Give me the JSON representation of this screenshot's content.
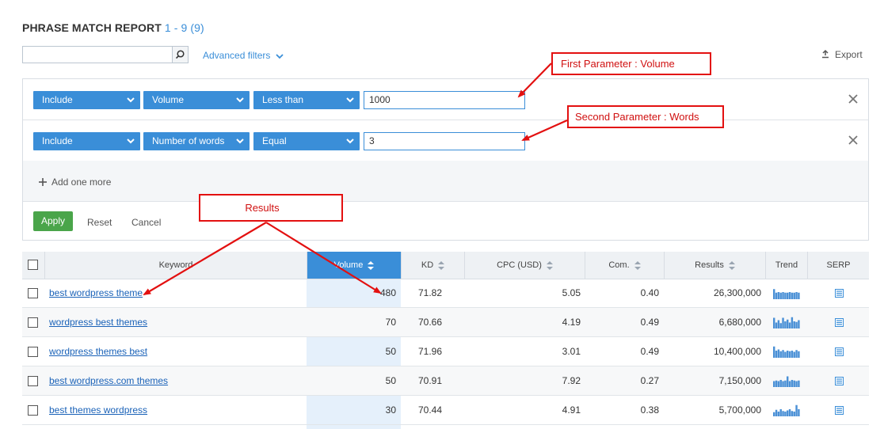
{
  "header": {
    "title": "PHRASE MATCH REPORT",
    "range": "1 - 9 (9)",
    "search_placeholder": "",
    "advanced_filters": "Advanced filters",
    "export": "Export"
  },
  "filters": [
    {
      "mode": "Include",
      "field": "Volume",
      "operator": "Less than",
      "value": "1000"
    },
    {
      "mode": "Include",
      "field": "Number of words",
      "operator": "Equal",
      "value": "3"
    }
  ],
  "filter_actions": {
    "add_one_more": "Add one more",
    "apply": "Apply",
    "reset": "Reset",
    "cancel": "Cancel"
  },
  "table": {
    "columns": [
      "Keyword",
      "Volume",
      "KD",
      "CPC (USD)",
      "Com.",
      "Results",
      "Trend",
      "SERP"
    ],
    "rows": [
      {
        "keyword": "best wordpress theme",
        "volume": "480",
        "kd": "71.82",
        "cpc": "5.05",
        "com": "0.40",
        "results": "26,300,000",
        "trend": [
          0.85,
          0.55,
          0.6,
          0.55,
          0.6,
          0.55,
          0.55,
          0.6,
          0.55,
          0.55,
          0.6,
          0.55
        ]
      },
      {
        "keyword": "wordpress best themes",
        "volume": "70",
        "kd": "70.66",
        "cpc": "4.19",
        "com": "0.49",
        "results": "6,680,000",
        "trend": [
          0.9,
          0.5,
          0.7,
          0.45,
          0.9,
          0.6,
          0.75,
          0.5,
          0.95,
          0.6,
          0.55,
          0.7
        ]
      },
      {
        "keyword": "wordpress themes best",
        "volume": "50",
        "kd": "71.96",
        "cpc": "3.01",
        "com": "0.49",
        "results": "10,400,000",
        "trend": [
          0.95,
          0.6,
          0.7,
          0.55,
          0.65,
          0.5,
          0.6,
          0.55,
          0.6,
          0.5,
          0.65,
          0.55
        ]
      },
      {
        "keyword": "best wordpress.com themes",
        "volume": "50",
        "kd": "70.91",
        "cpc": "7.92",
        "com": "0.27",
        "results": "7,150,000",
        "trend": [
          0.5,
          0.55,
          0.5,
          0.6,
          0.5,
          0.55,
          0.9,
          0.5,
          0.6,
          0.55,
          0.5,
          0.55
        ]
      },
      {
        "keyword": "best themes wordpress",
        "volume": "30",
        "kd": "70.44",
        "cpc": "4.91",
        "com": "0.38",
        "results": "5,700,000",
        "trend": [
          0.35,
          0.55,
          0.4,
          0.6,
          0.45,
          0.4,
          0.5,
          0.6,
          0.45,
          0.4,
          0.95,
          0.6
        ]
      }
    ]
  },
  "annotations": {
    "first": "First Parameter : Volume",
    "second": "Second Parameter : Words",
    "results": "Results",
    "color": "#e31010"
  },
  "colors": {
    "accent": "#3a8ed8",
    "apply": "#4aa54a",
    "link": "#1a62b8"
  }
}
